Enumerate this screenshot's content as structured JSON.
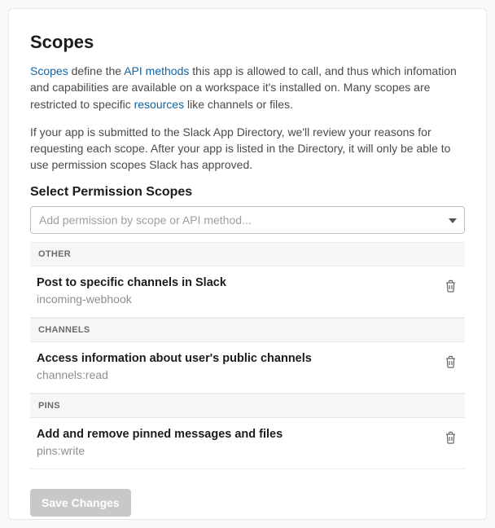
{
  "heading": "Scopes",
  "intro1_link1": "Scopes",
  "intro1_seg1": " define the ",
  "intro1_link2": "API methods",
  "intro1_seg2": " this app is allowed to call, and thus which infomation and capabilities are available on a workspace it's installed on. Many scopes are restricted to specific ",
  "intro1_link3": "resources",
  "intro1_seg3": " like channels or files.",
  "intro2": "If your app is submitted to the Slack App Directory, we'll review your reasons for requesting each scope. After your app is listed in the Directory, it will only be able to use permission scopes Slack has approved.",
  "select_heading": "Select Permission Scopes",
  "combo_placeholder": "Add permission by scope or API method...",
  "groups": {
    "0": {
      "label": "OTHER",
      "items": {
        "0": {
          "title": "Post to specific channels in Slack",
          "slug": "incoming-webhook"
        }
      }
    },
    "1": {
      "label": "CHANNELS",
      "items": {
        "0": {
          "title": "Access information about user's public channels",
          "slug": "channels:read"
        }
      }
    },
    "2": {
      "label": "PINS",
      "items": {
        "0": {
          "title": "Add and remove pinned messages and files",
          "slug": "pins:write"
        }
      }
    }
  },
  "save_label": "Save Changes"
}
